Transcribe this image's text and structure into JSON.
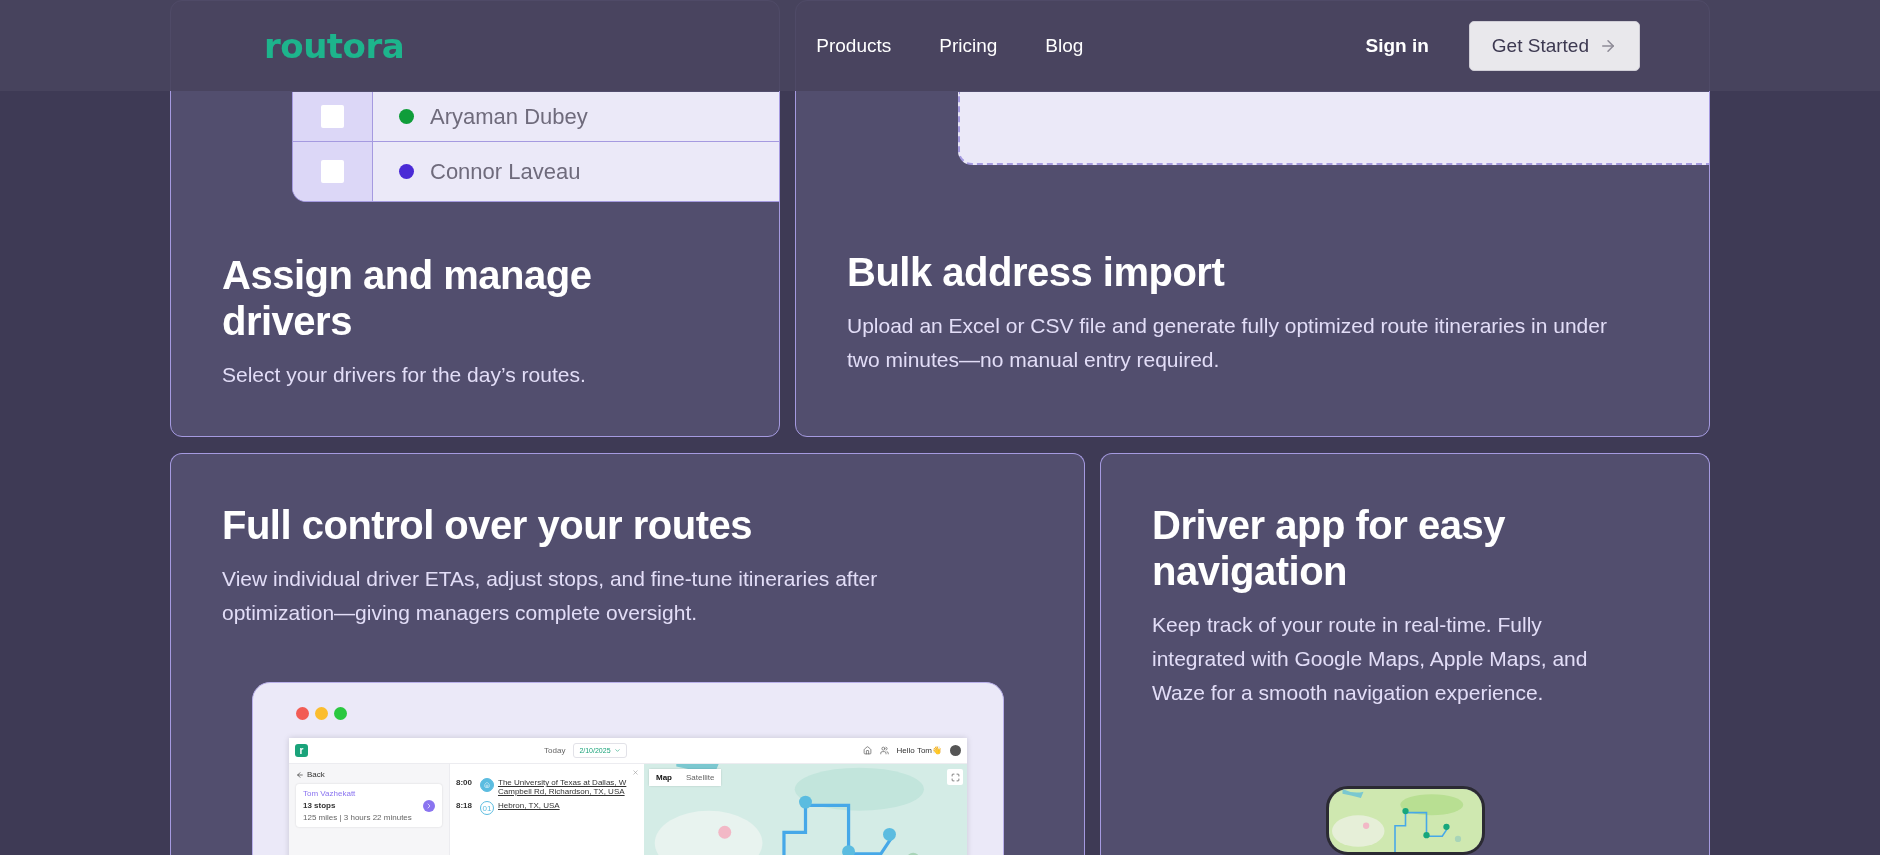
{
  "nav": {
    "logo": "routora",
    "links": [
      {
        "label": "Products"
      },
      {
        "label": "Pricing"
      },
      {
        "label": "Blog"
      }
    ],
    "sign_in": "Sign in",
    "cta": "Get Started"
  },
  "features": [
    {
      "kind": "drivers",
      "title": "Assign and manage drivers",
      "description": "Select your drivers for the day’s routes.",
      "drivers": [
        {
          "name": "Aryaman Dubey",
          "color": "#0f9d3a",
          "checked": false
        },
        {
          "name": "Connor Laveau",
          "color": "#4a2ad6",
          "checked": false
        }
      ]
    },
    {
      "kind": "import",
      "title": "Bulk address import",
      "description": "Upload an Excel or CSV file and generate fully optimized route itineraries in under two minutes—no manual entry required."
    },
    {
      "kind": "routes",
      "title": "Full control over your routes",
      "description": "View individual driver ETAs, adjust stops, and fine-tune itineraries after optimization—giving managers complete oversight.",
      "app": {
        "logo": "r",
        "today": "Today",
        "date": "2/10/2025",
        "greeting": "Hello Tom👋",
        "back": "Back",
        "driver": {
          "name": "Tom Vazhekatt",
          "stops": "13 stops",
          "summary": "125 miles | 3 hours 22 minutes"
        },
        "stops": [
          {
            "time": "8:00",
            "kind": "home",
            "address": "The University of Texas at Dallas, W Campbell Rd, Richardson, TX, USA"
          },
          {
            "time": "8:18",
            "kind": "number",
            "badge": "01",
            "address": "Hebron, TX, USA"
          }
        ],
        "map_tabs": [
          {
            "label": "Map",
            "selected": true
          },
          {
            "label": "Satellite",
            "selected": false
          }
        ]
      }
    },
    {
      "kind": "driver_app",
      "title": "Driver app for easy navigation",
      "description": "Keep track of your route in real-time. Fully integrated with Google Maps, Apple Maps, and Waze for a smooth navigation experience."
    }
  ]
}
